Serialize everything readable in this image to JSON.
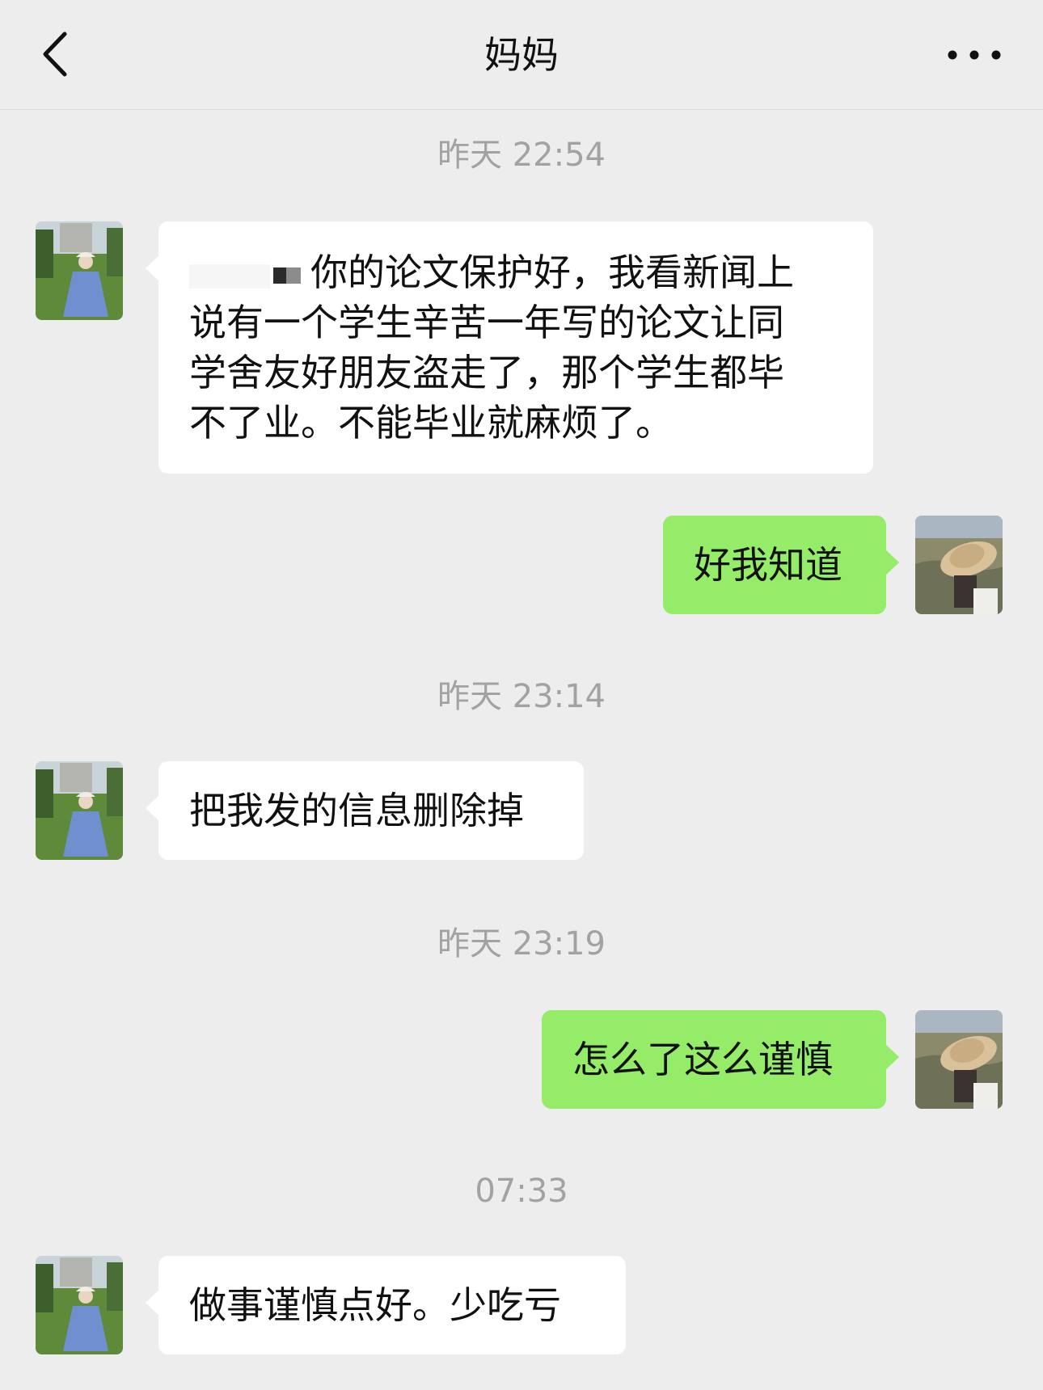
{
  "header": {
    "title": "妈妈",
    "back_icon": "chevron-left-icon",
    "more_icon": "ellipsis-icon"
  },
  "colors": {
    "background": "#ededed",
    "incoming_bubble": "#ffffff",
    "outgoing_bubble": "#95ec69",
    "timestamp": "#a2a2a2"
  },
  "messages": [
    {
      "type": "time",
      "text": "昨天 22:54"
    },
    {
      "type": "incoming",
      "sender": "妈妈",
      "lines": [
        "你的论文保护好，我看新闻上",
        "说有一个学生辛苦一年写的论文让同",
        "学舍友好朋友盗走了，那个学生都毕",
        "不了业。不能毕业就麻烦了。"
      ]
    },
    {
      "type": "outgoing",
      "text": "好我知道"
    },
    {
      "type": "time",
      "text": "昨天 23:14"
    },
    {
      "type": "incoming",
      "sender": "妈妈",
      "text": "把我发的信息删除掉"
    },
    {
      "type": "time",
      "text": "昨天 23:19"
    },
    {
      "type": "outgoing",
      "text": "怎么了这么谨慎"
    },
    {
      "type": "time",
      "text": "07:33"
    },
    {
      "type": "incoming",
      "sender": "妈妈",
      "text": "做事谨慎点好。少吃亏"
    }
  ]
}
